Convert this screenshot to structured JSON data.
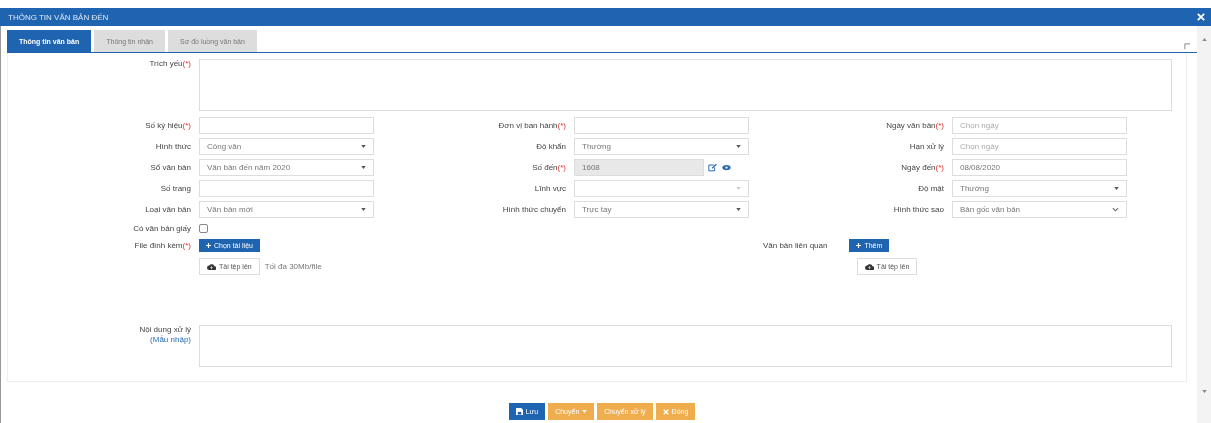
{
  "window": {
    "title": "THÔNG TIN VĂN BẢN ĐẾN"
  },
  "tabs": [
    {
      "label": "Thông tin văn bản",
      "selected": true
    },
    {
      "label": "Thông tin nhận",
      "selected": false
    },
    {
      "label": "Sơ đồ luồng văn bản",
      "selected": false
    }
  ],
  "summary": {
    "label": "Trích yếu",
    "required_mark": "(*)"
  },
  "columns": [
    [
      {
        "label": "Số ký hiệu",
        "required_mark": "(*)",
        "kind": "text"
      },
      {
        "label": "Hình thức",
        "kind": "select",
        "value": "Công văn"
      },
      {
        "label": "Sổ văn bản",
        "kind": "select",
        "value": "Văn bản đến năm 2020"
      },
      {
        "label": "Số trang",
        "kind": "text"
      },
      {
        "label": "Loại văn bản",
        "kind": "select",
        "value": "Văn bản mới"
      }
    ],
    [
      {
        "label": "Đơn vị ban hành",
        "required_mark": "(*)",
        "kind": "text"
      },
      {
        "label": "Độ khẩn",
        "kind": "select",
        "value": "Thường"
      },
      {
        "label": "Số đến",
        "required_mark": "(*)",
        "kind": "locked",
        "value": "1608"
      },
      {
        "label": "Lĩnh vực",
        "kind": "select-faint"
      },
      {
        "label": "Hình thức chuyển",
        "kind": "select",
        "value": "Trực tay"
      }
    ],
    [
      {
        "label": "Ngày văn bản",
        "required_mark": "(*)",
        "kind": "text",
        "placeholder": "Chọn ngày"
      },
      {
        "label": "Hạn xử lý",
        "kind": "text",
        "placeholder": "Chọn ngày"
      },
      {
        "label": "Ngày đến",
        "required_mark": "(*)",
        "kind": "text",
        "value": "08/08/2020"
      },
      {
        "label": "Độ mật",
        "kind": "select",
        "value": "Thường"
      },
      {
        "label": "Hình thức sao",
        "kind": "chevron",
        "value": "Bản gốc văn bản"
      }
    ]
  ],
  "paper": {
    "label": "Có văn bản giấy",
    "checked": false
  },
  "attachments": {
    "label": "File đính kèm",
    "required_mark": "(*)",
    "choose_button": "Chọn tài liệu",
    "upload_button": "Tải tệp lên",
    "limit": "Tối đa 30Mb/file"
  },
  "related": {
    "label": "Văn bản liên quan",
    "add_button": "Thêm",
    "upload_button": "Tải tệp lên"
  },
  "handling": {
    "label": "Nội dung xử lý",
    "template_link": "(Mẫu nhập)"
  },
  "buttons": [
    {
      "label": "Lưu",
      "kind": "save"
    },
    {
      "label": "Chuyển",
      "kind": "dropdown"
    },
    {
      "label": "Chuyển xử lý",
      "kind": "plain"
    },
    {
      "label": "Đóng",
      "kind": "close"
    }
  ]
}
